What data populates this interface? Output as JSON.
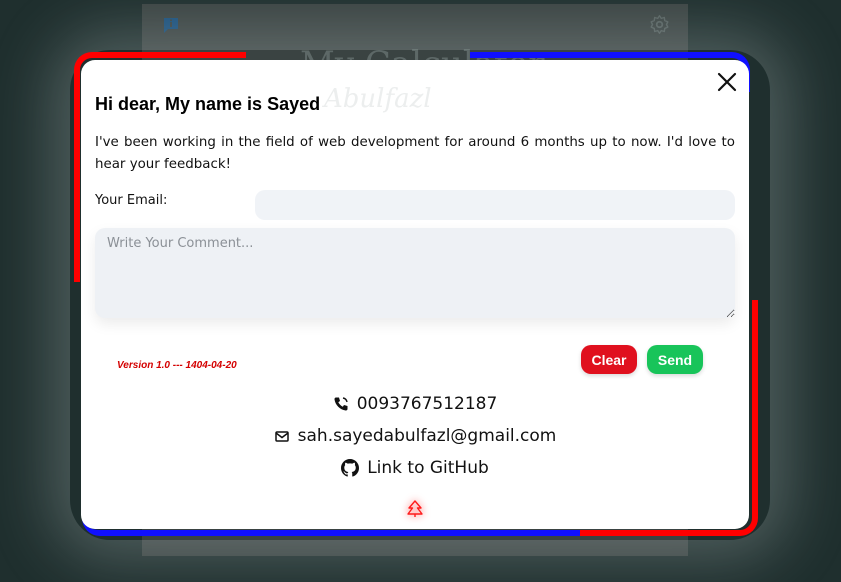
{
  "background": {
    "title": "My Calculator",
    "icons": [
      "info-icon",
      "gear-icon"
    ]
  },
  "modal": {
    "heading": "Hi dear, My name is Sayed",
    "heading_ghost": "Abulfazl",
    "intro": "I've been working in the field of web development for around 6 months up to now. I'd love to hear your feedback!",
    "email_label": "Your Email:",
    "email_value": "",
    "comment_placeholder": "Write Your Comment...",
    "version": "Version 1.0 --- 1404-04-20",
    "clear_label": "Clear",
    "send_label": "Send",
    "contacts": {
      "phone": "0093767512187",
      "email": "sah.sayedabulfazl@gmail.com",
      "github": "Link to GitHub"
    }
  },
  "colors": {
    "clear": "#e0101e",
    "send": "#18c45a",
    "frame_red": "#ff0000",
    "frame_blue": "#1010ff",
    "version": "#d40000"
  }
}
